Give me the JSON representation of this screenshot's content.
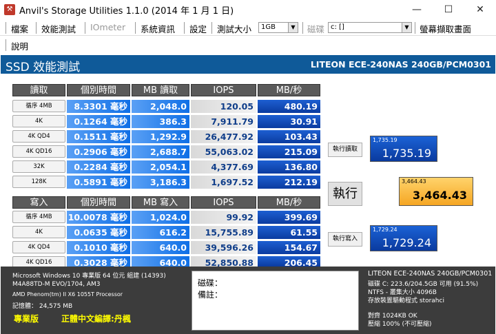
{
  "window": {
    "title": "Anvil's Storage Utilities 1.1.0 (2014 年 1 月 1 日)",
    "minimize": "—",
    "maximize": "☐",
    "close": "✕"
  },
  "menu": {
    "file": "檔案",
    "benchmark": "效能測試",
    "iometer": "IOmeter",
    "sysinfo": "系統資訊",
    "settings": "設定",
    "test_size_label": "測試大小",
    "test_size_value": "1GB",
    "disk_label": "磁碟",
    "disk_value": "c: []",
    "screenshot": "螢幕擷取畫面",
    "help": "說明"
  },
  "header": {
    "title": "SSD 效能測試",
    "drive": "LITEON ECE-240NAS 240GB/PCM0301"
  },
  "read_table": {
    "headers": [
      "讀取",
      "個別時間",
      "MB 讀取",
      "IOPS",
      "MB/秒"
    ],
    "rows": [
      {
        "label": "循序 4MB",
        "time": "8.3301 毫秒",
        "mb": "2,048.0",
        "iops": "120.05",
        "mbs": "480.19"
      },
      {
        "label": "4K",
        "time": "0.1264 毫秒",
        "mb": "386.3",
        "iops": "7,911.79",
        "mbs": "30.91"
      },
      {
        "label": "4K QD4",
        "time": "0.1511 毫秒",
        "mb": "1,292.9",
        "iops": "26,477.92",
        "mbs": "103.43"
      },
      {
        "label": "4K QD16",
        "time": "0.2906 毫秒",
        "mb": "2,688.7",
        "iops": "55,063.02",
        "mbs": "215.09"
      },
      {
        "label": "32K",
        "time": "0.2284 毫秒",
        "mb": "2,054.1",
        "iops": "4,377.69",
        "mbs": "136.80"
      },
      {
        "label": "128K",
        "time": "0.5891 毫秒",
        "mb": "3,186.3",
        "iops": "1,697.52",
        "mbs": "212.19"
      }
    ]
  },
  "write_table": {
    "headers": [
      "寫入",
      "個別時間",
      "MB 寫入",
      "IOPS",
      "MB/秒"
    ],
    "rows": [
      {
        "label": "循序 4MB",
        "time": "10.0078 毫秒",
        "mb": "1,024.0",
        "iops": "99.92",
        "mbs": "399.69"
      },
      {
        "label": "4K",
        "time": "0.0635 毫秒",
        "mb": "616.2",
        "iops": "15,755.89",
        "mbs": "61.55"
      },
      {
        "label": "4K QD4",
        "time": "0.1010 毫秒",
        "mb": "640.0",
        "iops": "39,596.26",
        "mbs": "154.67"
      },
      {
        "label": "4K QD16",
        "time": "0.3028 毫秒",
        "mb": "640.0",
        "iops": "52,850.88",
        "mbs": "206.45"
      }
    ]
  },
  "scores": {
    "run_read_button": "執行讀取",
    "read_small": "1,735.19",
    "read_big": "1,735.19",
    "run_button": "執行",
    "total_small": "3,464.43",
    "total_big": "3,464.43",
    "run_write_button": "執行寫入",
    "write_small": "1,729.24",
    "write_big": "1,729.24"
  },
  "sysinfo": {
    "os": "Microsoft Windows 10 專業版 64 位元 組建 (14393)",
    "board": "M4A88TD-M EVO/1704, AM3",
    "cpu": "AMD Phenom(tm) II X6 1055T Processor",
    "memory": "記憶體： 24,575 MB",
    "edition": "專業版",
    "translator": "正體中文編譯:丹楓"
  },
  "notes": {
    "disk": "磁碟：",
    "comment": "備註："
  },
  "driveinfo": {
    "name": "LITEON ECE-240NAS 240GB/PCM0301",
    "line1": "磁碟  C: 223.6/204.5GB 可用 (91.5%)",
    "line2": "NTFS - 叢集大小        4096B",
    "line3": "存放裝置驅動程式        storahci",
    "line4": "對齊        1024KB OK",
    "line5": "壓縮        100% (不可壓縮)"
  }
}
